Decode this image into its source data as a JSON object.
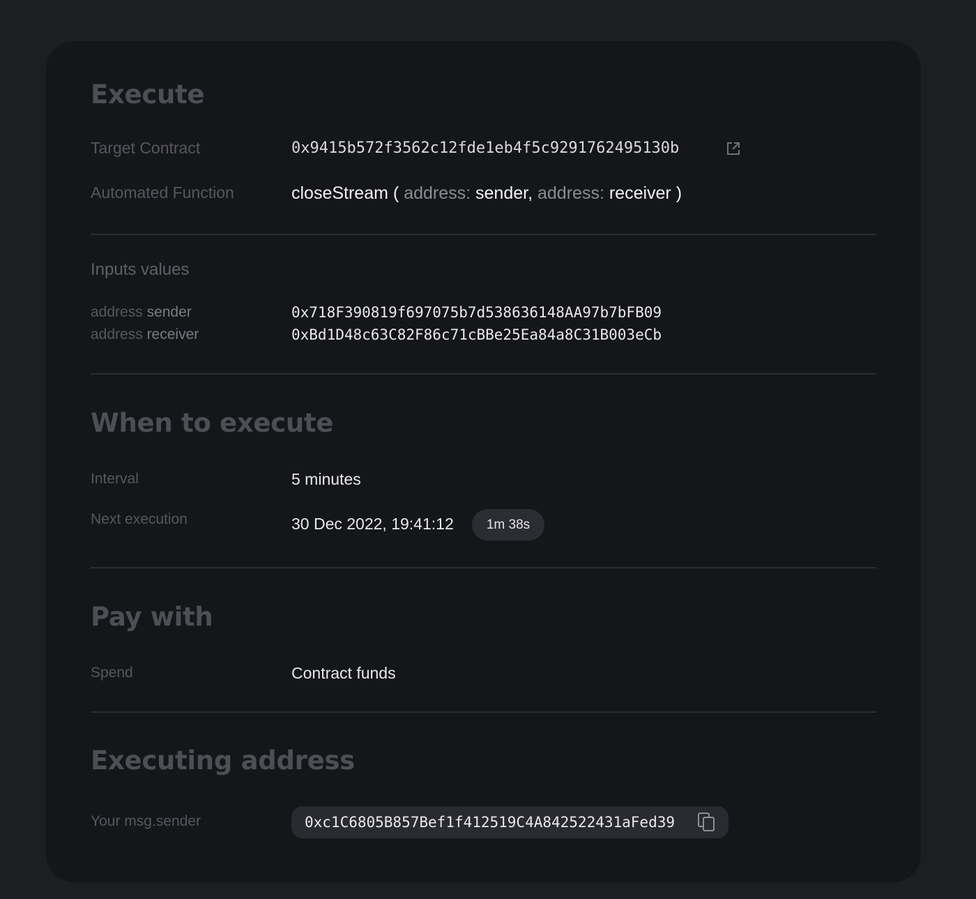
{
  "execute": {
    "title": "Execute",
    "target_contract": {
      "label": "Target Contract",
      "value": "0x9415b572f3562c12fde1eb4f5c9291762495130b"
    },
    "automated_function": {
      "label": "Automated Function",
      "name": "closeStream",
      "open_paren": "(",
      "param1_type": "address:",
      "param1_name": "sender,",
      "param2_type": "address:",
      "param2_name": "receiver",
      "close_paren": ")"
    }
  },
  "inputs": {
    "title": "Inputs values",
    "rows": [
      {
        "type": "address",
        "name": "sender",
        "value": "0x718F390819f697075b7d538636148AA97b7bFB09"
      },
      {
        "type": "address",
        "name": "receiver",
        "value": "0xBd1D48c63C82F86c71cBBe25Ea84a8C31B003eCb"
      }
    ]
  },
  "when": {
    "title": "When to execute",
    "interval_label": "Interval",
    "interval_value": "5 minutes",
    "next_label": "Next execution",
    "next_value": "30 Dec 2022, 19:41:12",
    "countdown": "1m 38s"
  },
  "pay": {
    "title": "Pay with",
    "spend_label": "Spend",
    "spend_value": "Contract funds"
  },
  "executing": {
    "title": "Executing address",
    "sender_label": "Your msg.sender",
    "sender_value": "0xc1C6805B857Bef1f412519C4A842522431aFed39"
  },
  "icons": {
    "external_link": "external-link-icon",
    "copy": "copy-icon"
  },
  "colors": {
    "page_background": "#1d1e22",
    "card_background": "#15161a",
    "section_title": "#4e4f55",
    "label": "#56575d",
    "value": "#e9e9ec",
    "divider": "#2b2c31",
    "pill_background": "#2a2b30"
  }
}
